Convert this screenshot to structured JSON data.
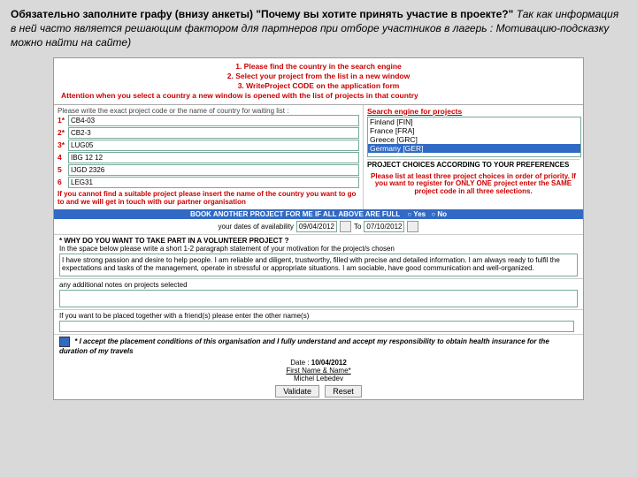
{
  "header": {
    "bold1": "Обязательно заполните графу (внизу анкеты) \"Почему вы хотите принять участие в проекте?\"",
    "italic1": "Так как информация в ней часто является решающим фактором для партнеров при отборе участников в лагерь : Мотивацию-подсказку можно найти на сайте)"
  },
  "instructions": {
    "line1": "1. Please find the country in the search engine",
    "line2": "2. Select your project from the list in a new window",
    "line3": "3. WriteProject CODE on the application form",
    "attention": "Attention when you select a country a new window is opened with the list of projects in that country"
  },
  "search": {
    "label": "Search engine for projects",
    "options": [
      "Finland [FIN]",
      "France [FRA]",
      "Greece [GRC]",
      "Germany [GER]"
    ]
  },
  "priority": {
    "intro": "Please write the exact project code or the name of country for waiting list :",
    "items": [
      "CB4-03",
      "CB2-3",
      "LUG05",
      "IBG 12 12",
      "IJGD 2326",
      "LEG31"
    ]
  },
  "notfound": "If you cannot find a suitable project please insert the name of the country you want to go to and we will get in touch with our partner organisation",
  "prioritynote": "Please list at least three project choices in order of priority. If you want to register for ONLY ONE project enter the SAME project code in all three selections.",
  "bookbar": "BOOK ANOTHER PROJECT FOR ME IF ALL ABOVE ARE FULL",
  "radios": {
    "yes": "Yes",
    "no": "No"
  },
  "dates": {
    "label": "your dates of availability",
    "from": "09/04/2012",
    "to_label": "To",
    "to": "07/10/2012"
  },
  "motivation": {
    "q": "* WHY DO YOU WANT TO TAKE PART IN A VOLUNTEER PROJECT ?",
    "hint": "In the space below please write a short 1-2 paragraph statement of your motivation for the project/s chosen",
    "val": "I have strong passion and desire to help people. I am reliable and diligent, trustworthy, filled with precise and detailed information. I am always ready to fulfil the expectations and tasks of the management, operate in stressful or appropriate situations. I am sociable, have good communication and well-organized."
  },
  "additional": {
    "label": "any additional notes on projects selected",
    "val": ""
  },
  "together": {
    "label": "If you want to be placed together with a friend(s) please enter the other name(s)"
  },
  "accept": "* I accept the placement conditions of this organisation and I fully understand and accept my responsibility to obtain health insurance for the duration of my travels",
  "footer": {
    "date_l": "Date :",
    "date_v": "10/04/2012",
    "name_l": "First Name & Name*",
    "name_v": "Michel Lebedev"
  },
  "buttons": {
    "validate": "Validate",
    "reset": "Reset"
  }
}
